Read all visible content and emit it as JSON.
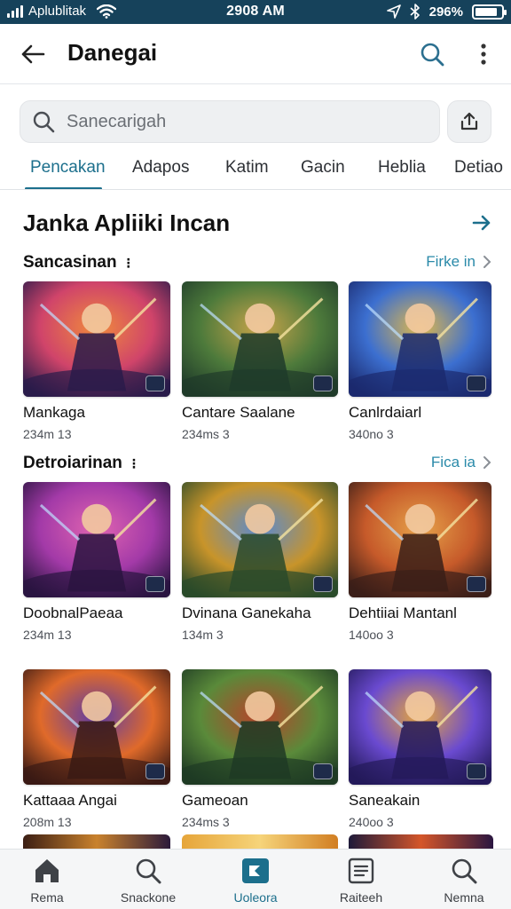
{
  "status_bar": {
    "carrier": "Aplublitak",
    "time": "2908 AM",
    "battery_percent": "296%",
    "battery_level": 0.85
  },
  "app_bar": {
    "title": "Danegai",
    "back_icon": "arrow-left-icon",
    "search_icon": "search-icon",
    "more_icon": "more-vertical-icon"
  },
  "search": {
    "placeholder": "Sanecarigah",
    "share_icon": "share-icon"
  },
  "tabs": [
    {
      "label": "Pencakan",
      "active": true
    },
    {
      "label": "Adapos",
      "active": false
    },
    {
      "label": "Katim",
      "active": false
    },
    {
      "label": "Gacin",
      "active": false
    },
    {
      "label": "Heblia",
      "active": false
    },
    {
      "label": "Detiao",
      "active": false
    }
  ],
  "section": {
    "title": "Janka Apliiki Incan"
  },
  "groups": [
    {
      "title": "Sancasinan",
      "link": "Firke in",
      "cards": [
        {
          "name": "Mankaga",
          "meta": "234m 13"
        },
        {
          "name": "Cantare Saalane",
          "meta": "234ms 3"
        },
        {
          "name": "Canlrdaiarl",
          "meta": "340no 3"
        }
      ]
    },
    {
      "title": "Detroiarinan",
      "link": "Fica ia",
      "cards": [
        {
          "name": "DoobnalPaeaa",
          "meta": "234m 13"
        },
        {
          "name": "Dvinana Ganekaha",
          "meta": "134m 3"
        },
        {
          "name": "Dehtiiai Mantanl",
          "meta": "140oo 3"
        }
      ]
    },
    {
      "title": "",
      "link": "",
      "cards": [
        {
          "name": "Kattaaa Angai",
          "meta": "208m 13"
        },
        {
          "name": "Gameoan",
          "meta": "234ms 3"
        },
        {
          "name": "Saneakain",
          "meta": "240oo 3"
        }
      ]
    }
  ],
  "bottom_nav": [
    {
      "label": "Rema",
      "icon": "home-icon",
      "active": false
    },
    {
      "label": "Snackone",
      "icon": "search-icon",
      "active": false
    },
    {
      "label": "Uoleora",
      "icon": "apps-icon",
      "active": true
    },
    {
      "label": "Raiteeh",
      "icon": "list-icon",
      "active": false
    },
    {
      "label": "Nemna",
      "icon": "search-icon",
      "active": false
    }
  ],
  "colors": {
    "accent": "#1c6f8c",
    "status_bar": "#16425b",
    "link": "#2a8aa9"
  }
}
